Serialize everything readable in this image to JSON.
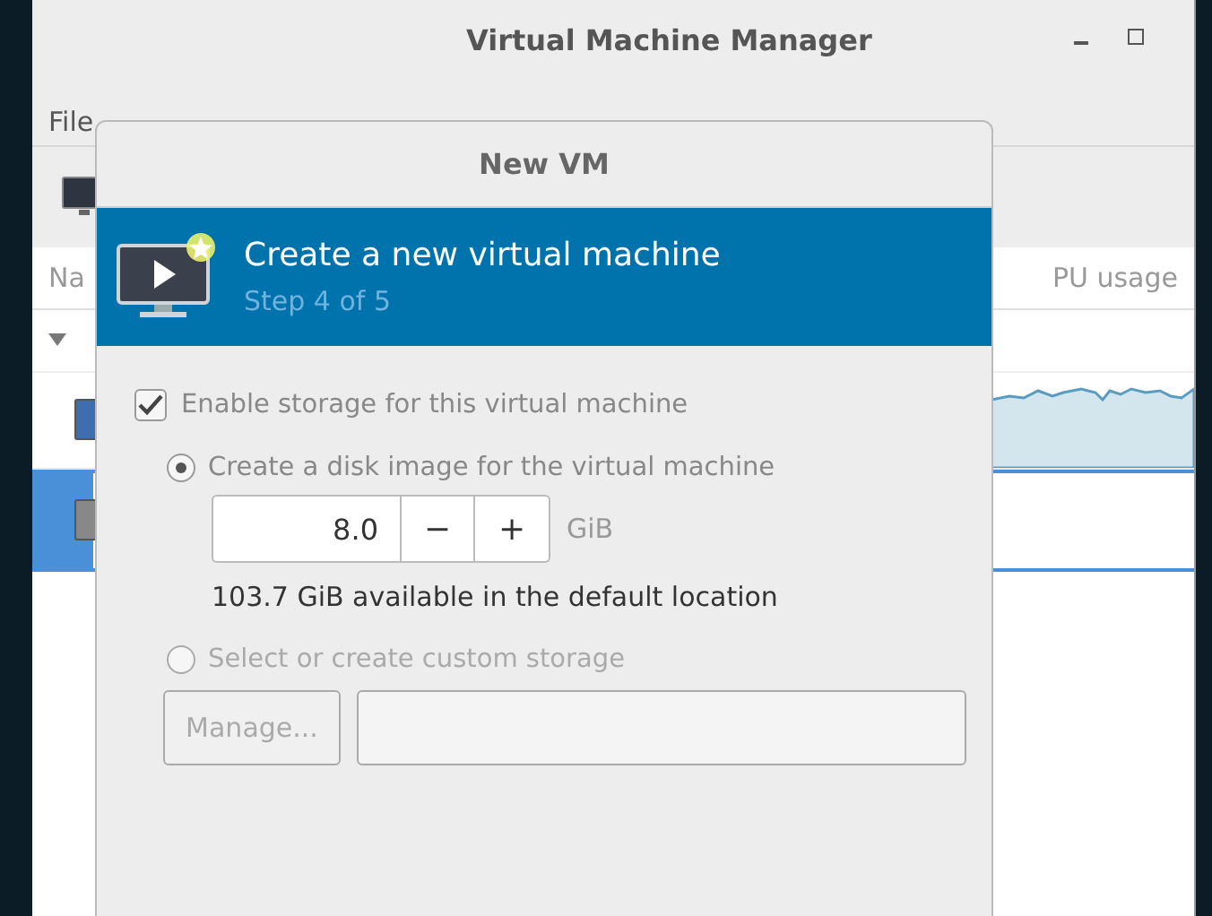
{
  "window": {
    "title": "Virtual Machine Manager"
  },
  "menu": [
    {
      "label": "File"
    }
  ],
  "columns": [
    "Na",
    "PU usage"
  ],
  "vm_rows": [
    {
      "selected": false
    },
    {
      "selected": true
    }
  ],
  "dialog": {
    "title": "New VM",
    "banner": {
      "title": "Create a new virtual machine",
      "step": "Step 4 of 5"
    },
    "enable_storage": {
      "label": "Enable storage for this virtual machine",
      "checked": true
    },
    "options": [
      {
        "label": "Create a disk image for the virtual machine",
        "selected": true,
        "disabled": false
      },
      {
        "label": "Select or create custom storage",
        "selected": false,
        "disabled": true
      }
    ],
    "disk_size": {
      "value": "8.0",
      "decrement": "−",
      "increment": "+",
      "unit": "GiB"
    },
    "available": "103.7 GiB available in the default location",
    "manage_button": {
      "label": "Manage...",
      "disabled": true
    }
  }
}
